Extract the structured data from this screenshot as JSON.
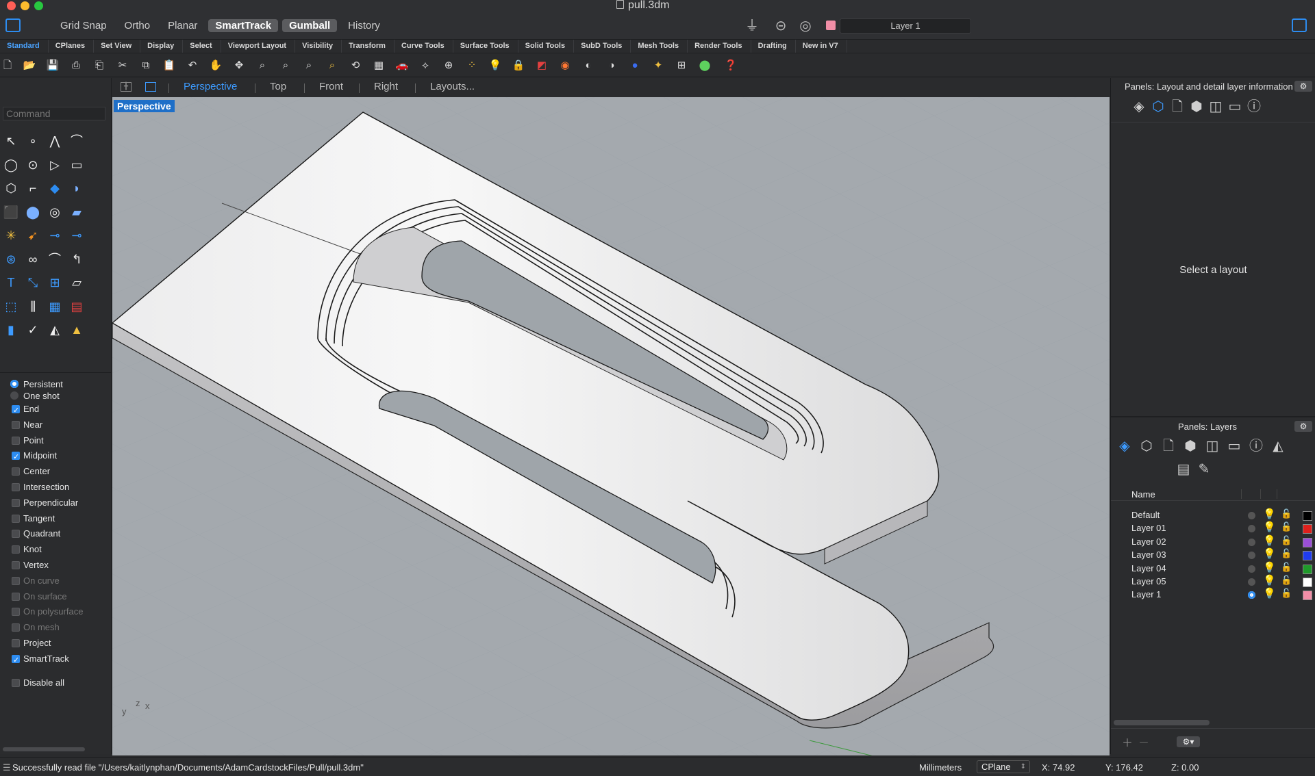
{
  "window": {
    "title": "pull.3dm"
  },
  "modes": [
    {
      "label": "Grid Snap",
      "on": false
    },
    {
      "label": "Ortho",
      "on": false
    },
    {
      "label": "Planar",
      "on": false
    },
    {
      "label": "SmartTrack",
      "on": true
    },
    {
      "label": "Gumball",
      "on": true
    },
    {
      "label": "History",
      "on": false
    }
  ],
  "current_layer": {
    "name": "Layer 1",
    "color": "#f18ea7"
  },
  "tabs": [
    "Standard",
    "CPlanes",
    "Set View",
    "Display",
    "Select",
    "Viewport Layout",
    "Visibility",
    "Transform",
    "Curve Tools",
    "Surface Tools",
    "Solid Tools",
    "SubD Tools",
    "Mesh Tools",
    "Render Tools",
    "Drafting",
    "New in V7"
  ],
  "active_tab": "Standard",
  "command": {
    "placeholder": "Command"
  },
  "osnap": {
    "mode_options": [
      {
        "label": "Persistent",
        "selected": true
      },
      {
        "label": "One shot",
        "selected": false
      }
    ],
    "items": [
      {
        "label": "End",
        "checked": true,
        "enabled": true
      },
      {
        "label": "Near",
        "checked": false,
        "enabled": true
      },
      {
        "label": "Point",
        "checked": false,
        "enabled": true
      },
      {
        "label": "Midpoint",
        "checked": true,
        "enabled": true
      },
      {
        "label": "Center",
        "checked": false,
        "enabled": true
      },
      {
        "label": "Intersection",
        "checked": false,
        "enabled": true
      },
      {
        "label": "Perpendicular",
        "checked": false,
        "enabled": true
      },
      {
        "label": "Tangent",
        "checked": false,
        "enabled": true
      },
      {
        "label": "Quadrant",
        "checked": false,
        "enabled": true
      },
      {
        "label": "Knot",
        "checked": false,
        "enabled": true
      },
      {
        "label": "Vertex",
        "checked": false,
        "enabled": true
      },
      {
        "label": "On curve",
        "checked": false,
        "enabled": false
      },
      {
        "label": "On surface",
        "checked": false,
        "enabled": false
      },
      {
        "label": "On polysurface",
        "checked": false,
        "enabled": false
      },
      {
        "label": "On mesh",
        "checked": false,
        "enabled": false
      },
      {
        "label": "Project",
        "checked": false,
        "enabled": true
      },
      {
        "label": "SmartTrack",
        "checked": true,
        "enabled": true
      }
    ],
    "disable_all": "Disable all"
  },
  "viewport_tabs": [
    "Perspective",
    "Top",
    "Front",
    "Right",
    "Layouts..."
  ],
  "active_viewport": "Perspective",
  "viewport_label": "Perspective",
  "axes": {
    "y": "y",
    "z": "z",
    "x": "x"
  },
  "panels": {
    "layout_title": "Panels: Layout and detail layer information",
    "layout_message": "Select a layout",
    "layers_title": "Panels: Layers",
    "name_header": "Name",
    "layers": [
      {
        "name": "Default",
        "color": "#000000",
        "current": false
      },
      {
        "name": "Layer 01",
        "color": "#e0201c",
        "current": false
      },
      {
        "name": "Layer 02",
        "color": "#9b4fd6",
        "current": false
      },
      {
        "name": "Layer 03",
        "color": "#1f3cf0",
        "current": false
      },
      {
        "name": "Layer 04",
        "color": "#1f9a2a",
        "current": false
      },
      {
        "name": "Layer 05",
        "color": "#ffffff",
        "current": false
      },
      {
        "name": "Layer 1",
        "color": "#f18ea7",
        "current": true
      }
    ]
  },
  "status": {
    "message": "Successfully read file \"/Users/kaitlynphan/Documents/AdamCardstockFiles/Pull/pull.3dm\"",
    "units": "Millimeters",
    "cplane": "CPlane",
    "x": "X: 74.92",
    "y": "Y: 176.42",
    "z": "Z: 0.00"
  }
}
